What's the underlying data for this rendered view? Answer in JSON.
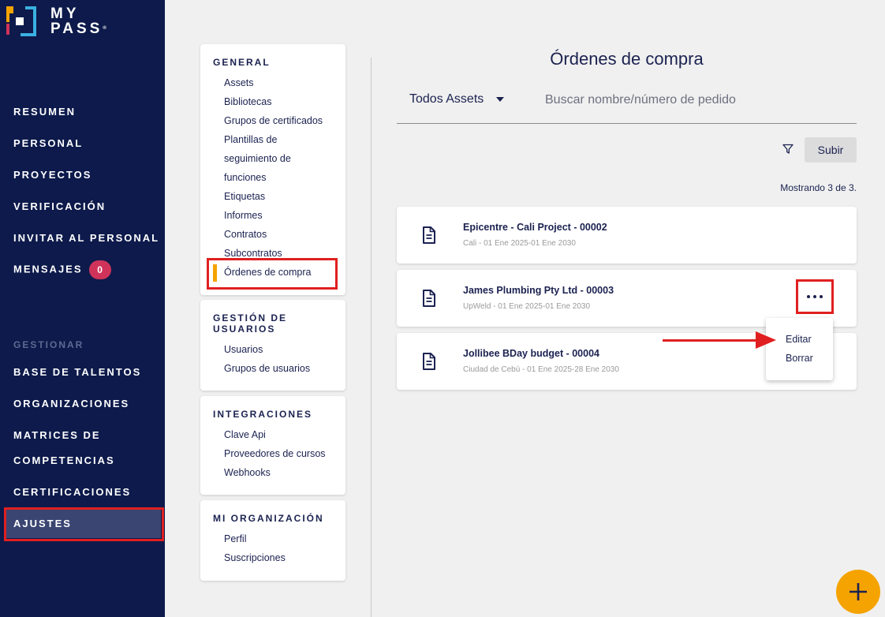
{
  "brand": {
    "line1": "MY",
    "line2": "PASS",
    "mark": "®"
  },
  "sidebar": {
    "items": [
      {
        "label": "RESUMEN"
      },
      {
        "label": "PERSONAL"
      },
      {
        "label": "PROYECTOS"
      },
      {
        "label": "VERIFICACIÓN"
      },
      {
        "label": "INVITAR AL PERSONAL"
      },
      {
        "label": "MENSAJES",
        "badge": "0"
      }
    ],
    "section_label": "GESTIONAR",
    "manage_items": [
      {
        "label": "BASE DE TALENTOS"
      },
      {
        "label": "ORGANIZACIONES"
      },
      {
        "label_line1": "MATRICES DE",
        "label_line2": "COMPETENCIAS"
      },
      {
        "label": "CERTIFICACIONES"
      },
      {
        "label": "AJUSTES"
      }
    ]
  },
  "settings_menu": {
    "general": {
      "title": "GENERAL",
      "links": [
        "Assets",
        "Bibliotecas",
        "Grupos de certificados",
        "Plantillas de",
        "seguimiento de",
        "funciones",
        "Etiquetas",
        "Informes",
        "Contratos",
        "Subcontratos",
        "Órdenes de compra"
      ]
    },
    "users": {
      "title_line1": "GESTIÓN DE",
      "title_line2": "USUARIOS",
      "links": [
        "Usuarios",
        "Grupos de usuarios"
      ]
    },
    "integrations": {
      "title": "INTEGRACIONES",
      "links": [
        "Clave Api",
        "Proveedores de cursos",
        "Webhooks"
      ]
    },
    "my_org": {
      "title": "MI ORGANIZACIÓN",
      "links": [
        "Perfil",
        "Suscripciones"
      ]
    }
  },
  "main": {
    "title": "Órdenes de compra",
    "asset_filter": "Todos Assets",
    "search_placeholder": "Buscar nombre/número de pedido",
    "upload_label": "Subir",
    "count_text": "Mostrando 3 de 3.",
    "orders": [
      {
        "title": "Epicentre - Cali Project - 00002",
        "subtitle": "Cali - 01 Ene 2025-01 Ene 2030"
      },
      {
        "title": "James Plumbing Pty Ltd - 00003",
        "subtitle": "UpWeld - 01 Ene 2025-01 Ene 2030"
      },
      {
        "title": "Jollibee BDay budget - 00004",
        "subtitle": "Ciudad de Cebú - 01 Ene 2025-28 Ene 2030"
      }
    ],
    "row_menu": {
      "edit": "Editar",
      "delete": "Borrar"
    }
  },
  "colors": {
    "sidebar": "#0d1a4b",
    "accent": "#f5a300",
    "highlight": "#e02020",
    "badge": "#d0335a"
  },
  "icons": {
    "filter": "filter-icon",
    "document": "document-icon",
    "add": "plus-icon",
    "more": "more-horizontal-icon"
  }
}
